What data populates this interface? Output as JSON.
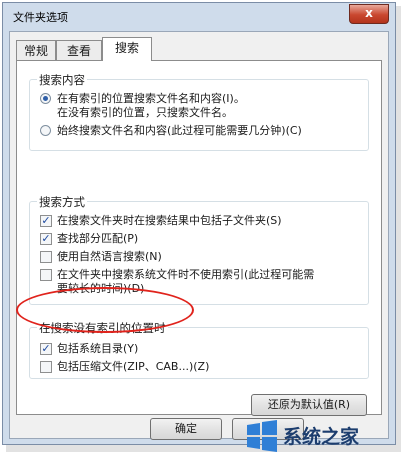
{
  "window": {
    "title": "文件夹选项",
    "close_label": "x"
  },
  "tabs": [
    {
      "label": "常规",
      "active": false
    },
    {
      "label": "查看",
      "active": false
    },
    {
      "label": "搜索",
      "active": true
    }
  ],
  "search_content": {
    "title": "搜索内容",
    "option1_line1": "在有索引的位置搜索文件名和内容(I)。",
    "option1_line2": "在没有索引的位置，只搜索文件名。",
    "option1_selected": true,
    "option2": "始终搜索文件名和内容(此过程可能需要几分钟)(C)",
    "option2_selected": false
  },
  "search_method": {
    "title": "搜索方式",
    "items": [
      {
        "line1": "在搜索文件夹时在搜索结果中包括子文件夹(S)",
        "line2": "",
        "checked": true
      },
      {
        "line1": "查找部分匹配(P)",
        "line2": "",
        "checked": true
      },
      {
        "line1": "使用自然语言搜索(N)",
        "line2": "",
        "checked": false
      },
      {
        "line1": "在文件夹中搜索系统文件时不使用索引(此过程可能需",
        "line2": "要较长的时间)(D)",
        "checked": false
      }
    ]
  },
  "no_index": {
    "title": "在搜索没有索引的位置时",
    "items": [
      {
        "label": "包括系统目录(Y)",
        "checked": true
      },
      {
        "label": "包括压缩文件(ZIP、CAB...)(Z)",
        "checked": false
      }
    ]
  },
  "buttons": {
    "restore_defaults": "还原为默认值(R)",
    "ok": "确定"
  },
  "watermark": {
    "text": "系统之家"
  },
  "colors": {
    "highlight": "#e0231c",
    "accent": "#2f5fa8"
  }
}
